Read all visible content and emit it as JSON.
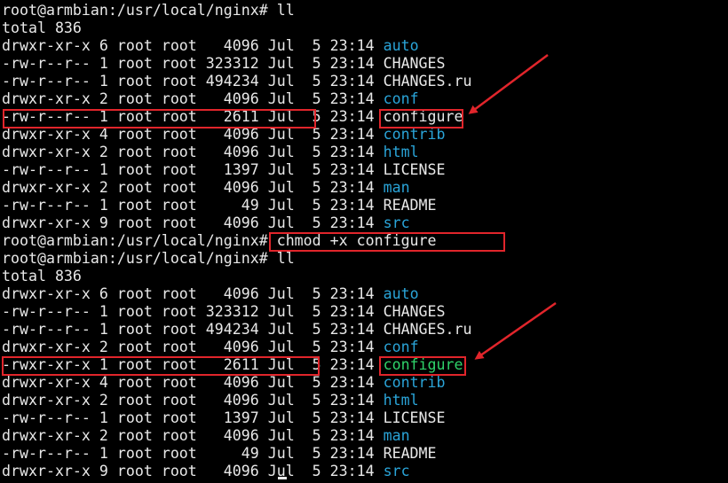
{
  "terminal": {
    "lines": [
      {
        "parts": [
          {
            "t": "root@armbian:/usr/local/nginx# ll"
          }
        ]
      },
      {
        "parts": [
          {
            "t": "total 836"
          }
        ]
      },
      {
        "parts": [
          {
            "t": "drwxr-xr-x 6 root root   4096 Jul  5 23:14 "
          },
          {
            "t": "auto",
            "c": "dir"
          }
        ]
      },
      {
        "parts": [
          {
            "t": "-rw-r--r-- 1 root root 323312 Jul  5 23:14 CHANGES"
          }
        ]
      },
      {
        "parts": [
          {
            "t": "-rw-r--r-- 1 root root 494234 Jul  5 23:14 CHANGES.ru"
          }
        ]
      },
      {
        "parts": [
          {
            "t": "drwxr-xr-x 2 root root   4096 Jul  5 23:14 "
          },
          {
            "t": "conf",
            "c": "dir"
          }
        ]
      },
      {
        "parts": [
          {
            "t": "-rw-r--r-- 1 root root   2611 Jul  5 23:14 configure"
          }
        ]
      },
      {
        "parts": [
          {
            "t": "drwxr-xr-x 4 root root   4096 Jul  5 23:14 "
          },
          {
            "t": "contrib",
            "c": "dir"
          }
        ]
      },
      {
        "parts": [
          {
            "t": "drwxr-xr-x 2 root root   4096 Jul  5 23:14 "
          },
          {
            "t": "html",
            "c": "dir"
          }
        ]
      },
      {
        "parts": [
          {
            "t": "-rw-r--r-- 1 root root   1397 Jul  5 23:14 LICENSE"
          }
        ]
      },
      {
        "parts": [
          {
            "t": "drwxr-xr-x 2 root root   4096 Jul  5 23:14 "
          },
          {
            "t": "man",
            "c": "dir"
          }
        ]
      },
      {
        "parts": [
          {
            "t": "-rw-r--r-- 1 root root     49 Jul  5 23:14 README"
          }
        ]
      },
      {
        "parts": [
          {
            "t": "drwxr-xr-x 9 root root   4096 Jul  5 23:14 "
          },
          {
            "t": "src",
            "c": "dir"
          }
        ]
      },
      {
        "parts": [
          {
            "t": "root@armbian:/usr/local/nginx# chmod +x configure"
          }
        ]
      },
      {
        "parts": [
          {
            "t": "root@armbian:/usr/local/nginx# ll"
          }
        ]
      },
      {
        "parts": [
          {
            "t": "total 836"
          }
        ]
      },
      {
        "parts": [
          {
            "t": "drwxr-xr-x 6 root root   4096 Jul  5 23:14 "
          },
          {
            "t": "auto",
            "c": "dir"
          }
        ]
      },
      {
        "parts": [
          {
            "t": "-rw-r--r-- 1 root root 323312 Jul  5 23:14 CHANGES"
          }
        ]
      },
      {
        "parts": [
          {
            "t": "-rw-r--r-- 1 root root 494234 Jul  5 23:14 CHANGES.ru"
          }
        ]
      },
      {
        "parts": [
          {
            "t": "drwxr-xr-x 2 root root   4096 Jul  5 23:14 "
          },
          {
            "t": "conf",
            "c": "dir"
          }
        ]
      },
      {
        "parts": [
          {
            "t": "-rwxr-xr-x 1 root root   2611 Jul  5 23:14 "
          },
          {
            "t": "configure",
            "c": "exe"
          }
        ]
      },
      {
        "parts": [
          {
            "t": "drwxr-xr-x 4 root root   4096 Jul  5 23:14 "
          },
          {
            "t": "contrib",
            "c": "dir"
          }
        ]
      },
      {
        "parts": [
          {
            "t": "drwxr-xr-x 2 root root   4096 Jul  5 23:14 "
          },
          {
            "t": "html",
            "c": "dir"
          }
        ]
      },
      {
        "parts": [
          {
            "t": "-rw-r--r-- 1 root root   1397 Jul  5 23:14 LICENSE"
          }
        ]
      },
      {
        "parts": [
          {
            "t": "drwxr-xr-x 2 root root   4096 Jul  5 23:14 "
          },
          {
            "t": "man",
            "c": "dir"
          }
        ]
      },
      {
        "parts": [
          {
            "t": "-rw-r--r-- 1 root root     49 Jul  5 23:14 README"
          }
        ]
      },
      {
        "parts": [
          {
            "t": "drwxr-xr-x 9 root root   4096 Jul  5 23:14 "
          },
          {
            "t": "src",
            "c": "dir"
          }
        ]
      }
    ]
  },
  "colors": {
    "background": "#000000",
    "text": "#e8e8e8",
    "directory": "#2aa4d8",
    "executable": "#2fd36a",
    "annotation": "#e1252b"
  }
}
